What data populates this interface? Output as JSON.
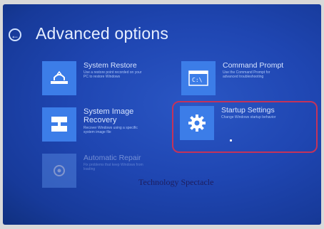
{
  "header": {
    "back_icon": "left-arrow-circle-icon",
    "title": "Advanced options"
  },
  "options": [
    {
      "id": "system-restore",
      "icon": "system-restore-icon",
      "title": "System Restore",
      "desc_lines": [
        "Use a restore point recorded on your",
        "PC to restore Windows"
      ]
    },
    {
      "id": "command-prompt",
      "icon": "command-prompt-icon",
      "title": "Command Prompt",
      "desc_lines": [
        "Use the Command Prompt for",
        "advanced troubleshooting"
      ]
    },
    {
      "id": "system-image-recovery",
      "icon": "system-image-recovery-icon",
      "title_lines": [
        "System Image",
        "Recovery"
      ],
      "desc_lines": [
        "Recover Windows using a specific",
        "system image file"
      ]
    },
    {
      "id": "startup-settings",
      "icon": "gear-icon",
      "title": "Startup Settings",
      "desc_lines": [
        "Change Windows startup behavior"
      ]
    },
    {
      "id": "automatic-repair",
      "icon": "automatic-repair-icon",
      "title": "Automatic Repair",
      "desc_lines": [
        "Fix problems that keep Windows from",
        "loading"
      ]
    }
  ],
  "watermark": "Technology Spectacle",
  "colors": {
    "background": "#1f46b2",
    "tile": "#3c7de8",
    "highlight_ring": "#c4335a",
    "title_text": "#e6eeff"
  }
}
